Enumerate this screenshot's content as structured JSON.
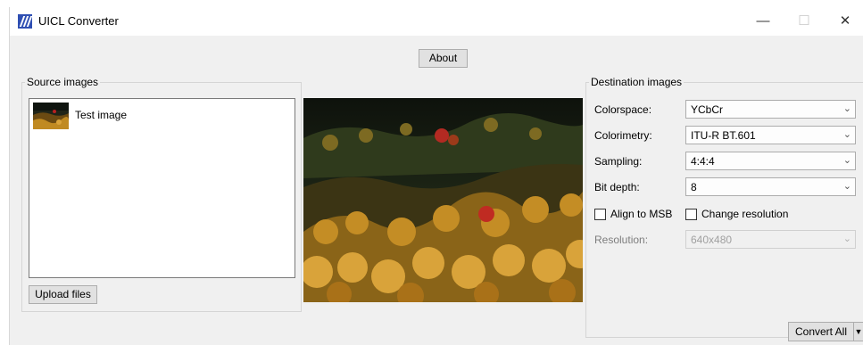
{
  "window": {
    "title": "UICL Converter",
    "controls": {
      "minimize": "—",
      "maximize": "☐",
      "close": "✕"
    }
  },
  "toolbar": {
    "about_label": "About"
  },
  "source": {
    "group_label": "Source images",
    "items": [
      {
        "label": "Test image"
      }
    ],
    "upload_label": "Upload files"
  },
  "destination": {
    "group_label": "Destination images",
    "colorspace": {
      "label": "Colorspace:",
      "value": "YCbCr"
    },
    "colorimetry": {
      "label": "Colorimetry:",
      "value": "ITU-R BT.601"
    },
    "sampling": {
      "label": "Sampling:",
      "value": "4:4:4"
    },
    "bit_depth": {
      "label": "Bit depth:",
      "value": "8"
    },
    "align_msb": {
      "label": "Align to MSB",
      "checked": false
    },
    "change_resolution": {
      "label": "Change resolution",
      "checked": false
    },
    "resolution": {
      "label": "Resolution:",
      "value": "640x480",
      "enabled": false
    }
  },
  "actions": {
    "convert_all_label": "Convert All",
    "dropdown_glyph": "▼"
  },
  "icons": {
    "app": "app-logo-icon",
    "dropdown": "chevron-down-icon",
    "checkbox": "checkbox-icon"
  },
  "colors": {
    "window_bg": "#f0f0f0",
    "app_icon": "#2f4fb3",
    "button_bg": "#e1e1e1"
  }
}
